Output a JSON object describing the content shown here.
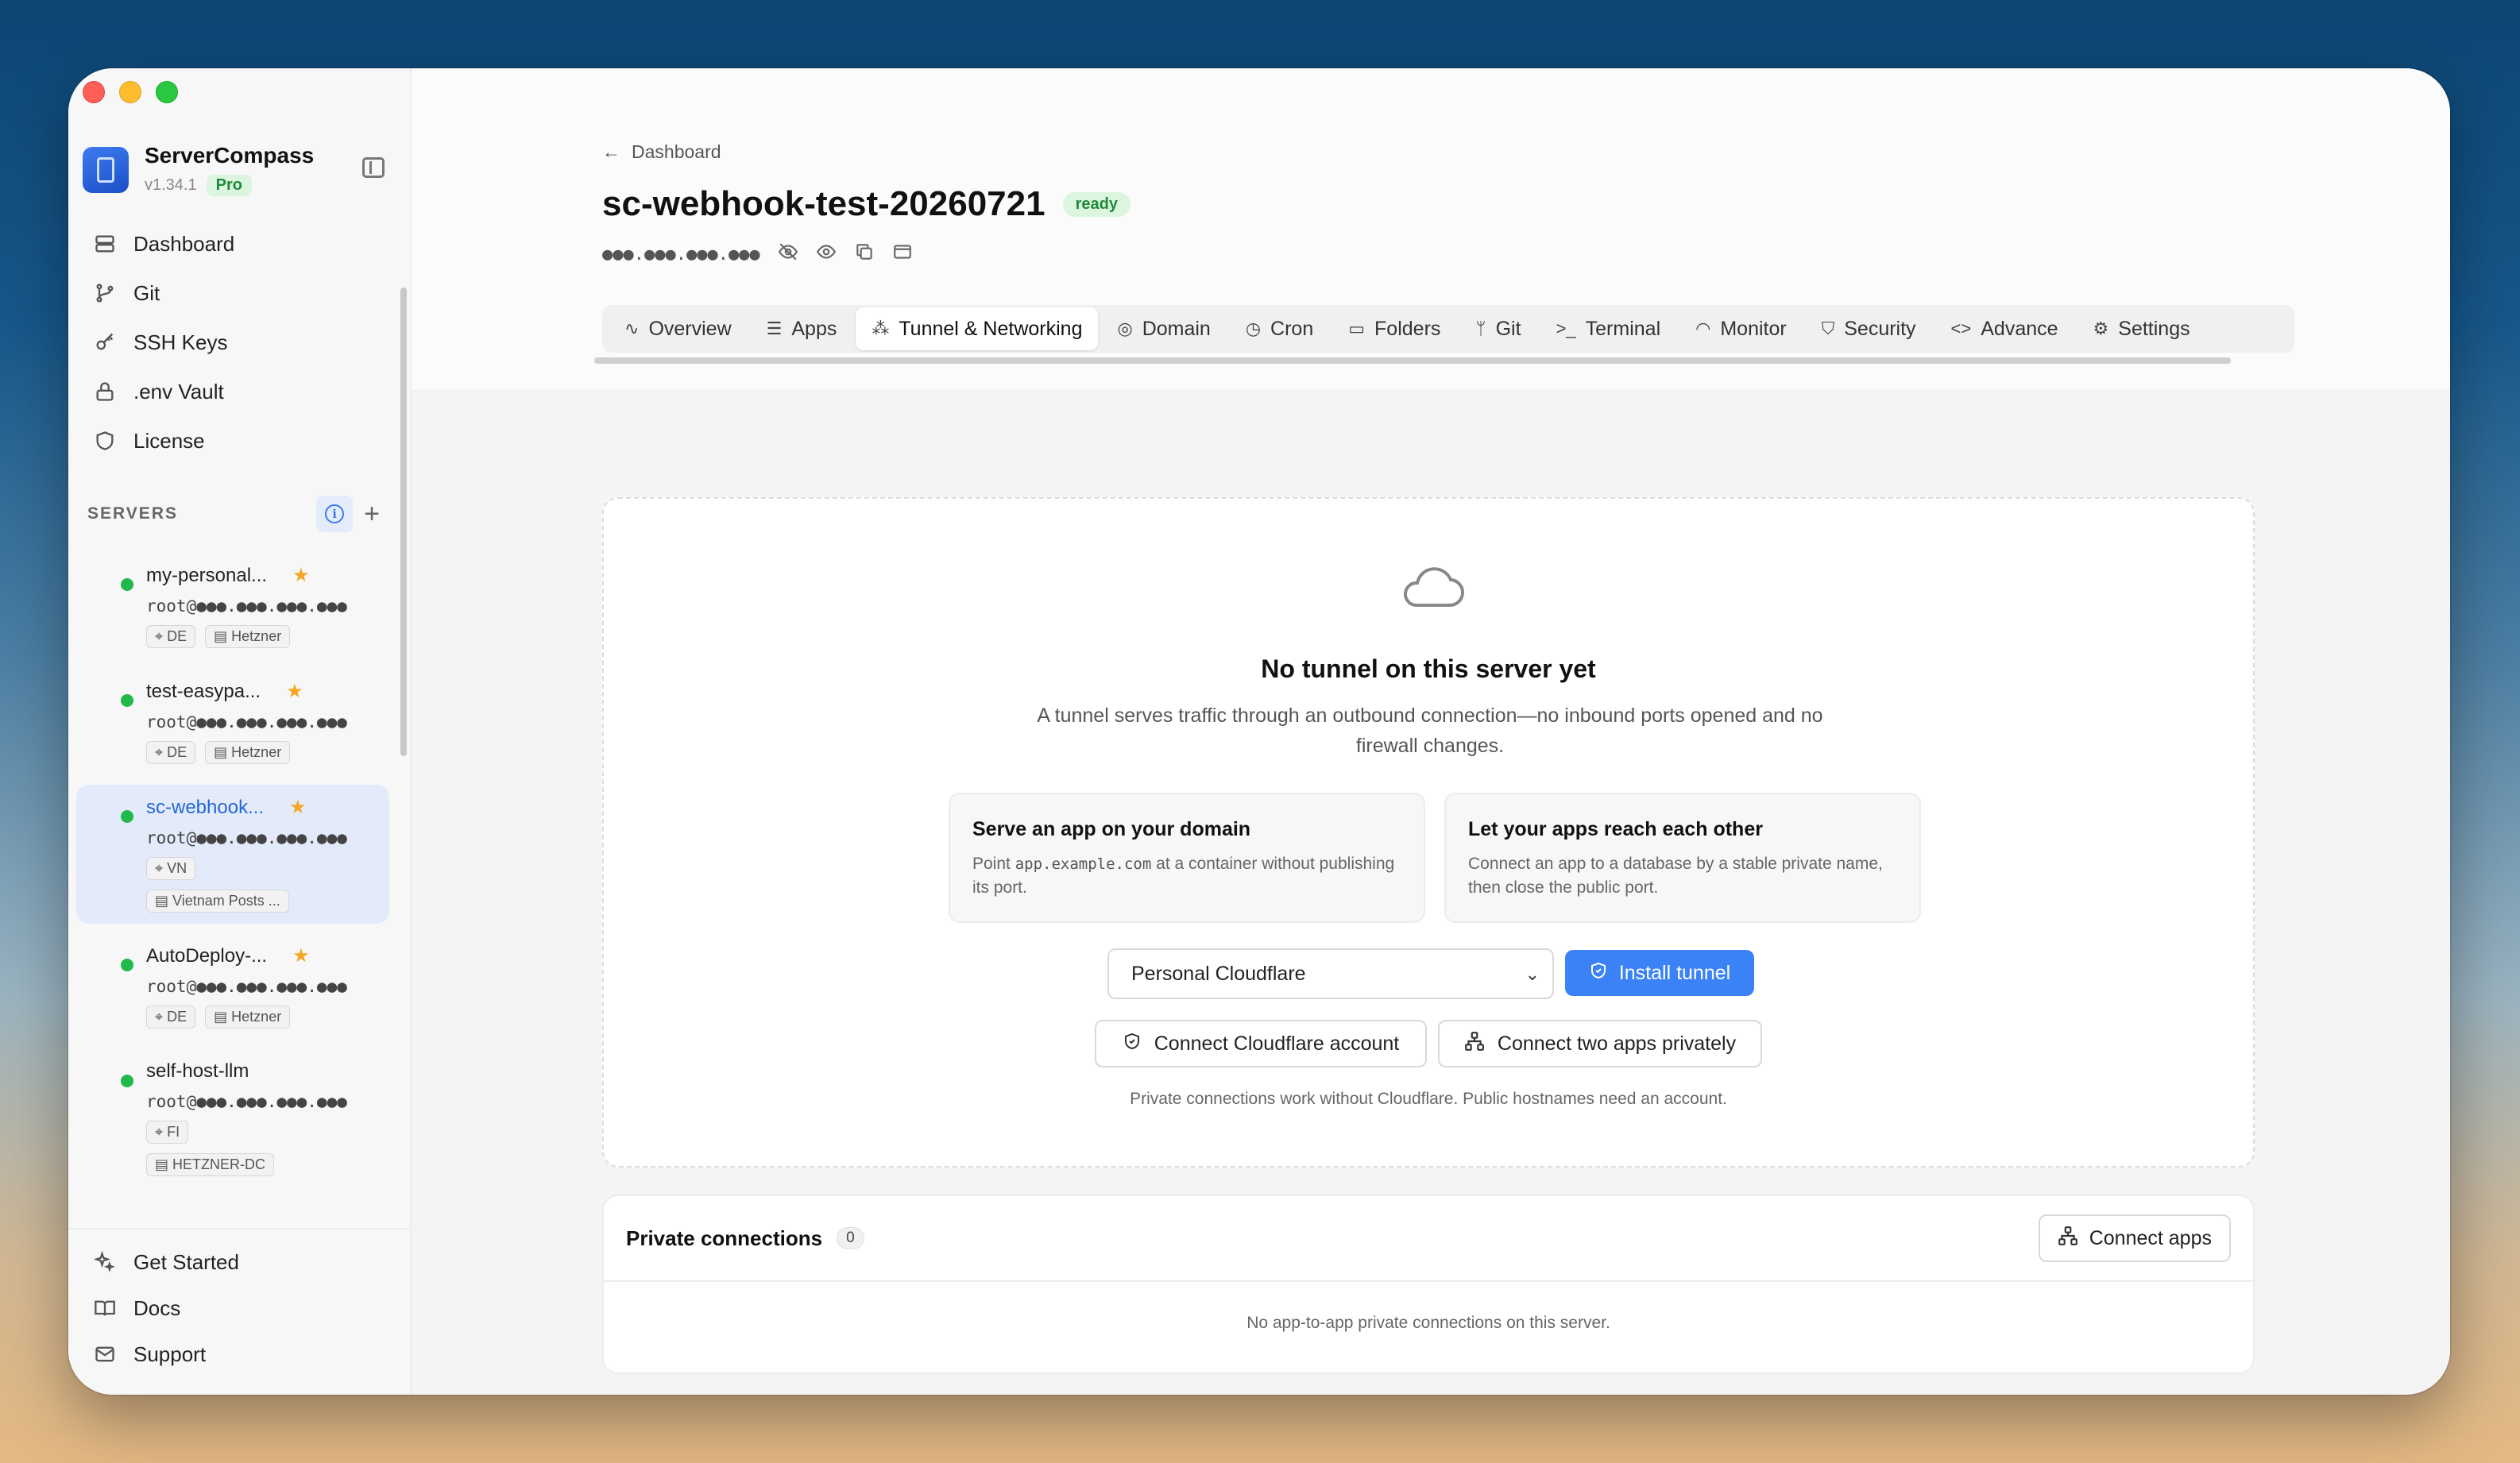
{
  "app": {
    "name": "ServerCompass",
    "version": "v1.34.1",
    "plan": "Pro"
  },
  "nav": [
    {
      "label": "Dashboard",
      "icon": "server-stack-icon"
    },
    {
      "label": "Git",
      "icon": "git-branch-icon"
    },
    {
      "label": "SSH Keys",
      "icon": "key-icon"
    },
    {
      "label": ".env Vault",
      "icon": "lock-icon"
    },
    {
      "label": "License",
      "icon": "shield-icon"
    }
  ],
  "servers_section": {
    "label": "SERVERS"
  },
  "servers": [
    {
      "name": "my-personal...",
      "host": "root@●●●.●●●.●●●.●●●",
      "tags": [
        "DE",
        "Hetzner"
      ],
      "starred": true,
      "status": "online"
    },
    {
      "name": "test-easypa...",
      "host": "root@●●●.●●●.●●●.●●●",
      "tags": [
        "DE",
        "Hetzner"
      ],
      "starred": true,
      "status": "online"
    },
    {
      "name": "sc-webhook...",
      "host": "root@●●●.●●●.●●●.●●●",
      "tags": [
        "VN",
        "Vietnam Posts ..."
      ],
      "starred": true,
      "status": "online",
      "active": true
    },
    {
      "name": "AutoDeploy-...",
      "host": "root@●●●.●●●.●●●.●●●",
      "tags": [
        "DE",
        "Hetzner"
      ],
      "starred": true,
      "status": "online"
    },
    {
      "name": "self-host-llm",
      "host": "root@●●●.●●●.●●●.●●●",
      "tags": [
        "FI",
        "HETZNER-DC"
      ],
      "starred": false,
      "status": "online"
    }
  ],
  "bottom_nav": [
    {
      "label": "Get Started",
      "icon": "sparkles-icon"
    },
    {
      "label": "Docs",
      "icon": "book-icon"
    },
    {
      "label": "Support",
      "icon": "mail-icon"
    }
  ],
  "header": {
    "back_label": "Dashboard",
    "title": "sc-webhook-test-20260721",
    "status": "ready",
    "ip_masked": "●●●.●●●.●●●.●●●"
  },
  "tabs": [
    {
      "label": "Overview",
      "icon": "activity-icon"
    },
    {
      "label": "Apps",
      "icon": "layers-icon"
    },
    {
      "label": "Tunnel & Networking",
      "icon": "network-icon",
      "active": true
    },
    {
      "label": "Domain",
      "icon": "globe-icon"
    },
    {
      "label": "Cron",
      "icon": "clock-icon"
    },
    {
      "label": "Folders",
      "icon": "folder-icon"
    },
    {
      "label": "Git",
      "icon": "git-branch-icon"
    },
    {
      "label": "Terminal",
      "icon": "terminal-icon"
    },
    {
      "label": "Monitor",
      "icon": "gauge-icon"
    },
    {
      "label": "Security",
      "icon": "shield-icon"
    },
    {
      "label": "Advance",
      "icon": "code-icon"
    },
    {
      "label": "Settings",
      "icon": "gear-icon"
    }
  ],
  "tunnel": {
    "empty_title": "No tunnel on this server yet",
    "empty_desc": "A tunnel serves traffic through an outbound connection—no inbound ports opened and no firewall changes.",
    "feature_1": {
      "title": "Serve an app on your domain",
      "desc_pre": "Point",
      "desc_code": "app.example.com",
      "desc_post": "at a container without publishing its port."
    },
    "feature_2": {
      "title": "Let your apps reach each other",
      "desc": "Connect an app to a database by a stable private name, then close the public port."
    },
    "provider_selected": "Personal Cloudflare",
    "install_label": "Install tunnel",
    "connect_cf_label": "Connect Cloudflare account",
    "connect_two_label": "Connect two apps privately",
    "hint": "Private connections work without Cloudflare. Public hostnames need an account."
  },
  "private_connections": {
    "title": "Private connections",
    "count": "0",
    "connect_label": "Connect apps",
    "empty": "No app-to-app private connections on this server."
  },
  "colors": {
    "accent": "#3b82f6",
    "ready": "#1f8a3a",
    "status_online": "#21b84c",
    "star": "#f5a623"
  }
}
